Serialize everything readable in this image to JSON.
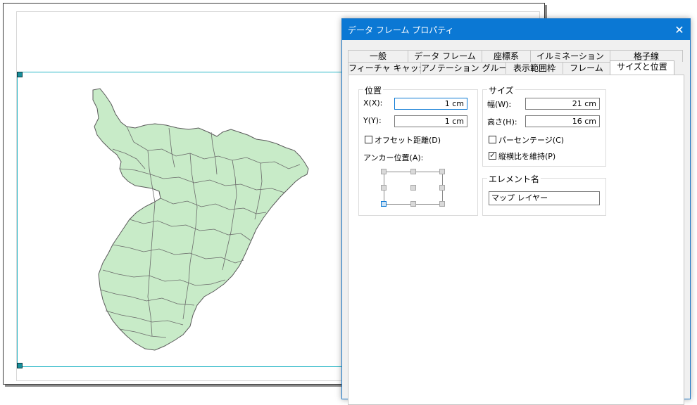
{
  "dialog": {
    "title": "データ フレーム プロパティ",
    "close_glyph": "✕",
    "tabs_row1": [
      "一般",
      "データ フレーム",
      "座標系",
      "イルミネーション",
      "格子線"
    ],
    "tabs_row2": [
      "フィーチャ キャッシュ",
      "アノテーション グループ",
      "表示範囲枠",
      "フレーム",
      "サイズと位置"
    ],
    "active_tab": "サイズと位置"
  },
  "position": {
    "title": "位置",
    "x_label": "X(X):",
    "x_value": "1 cm",
    "y_label": "Y(Y):",
    "y_value": "1 cm",
    "offset_label": "オフセット距離(D)",
    "offset_checked": false,
    "anchor_label": "アンカー位置(A):",
    "anchor_selected": "bottom-left"
  },
  "size": {
    "title": "サイズ",
    "width_label": "幅(W):",
    "width_value": "21 cm",
    "height_label": "高さ(H):",
    "height_value": "16 cm",
    "percent_label": "パーセンテージ(C)",
    "percent_checked": false,
    "aspect_label": "縦横比を維持(P)",
    "aspect_checked": true
  },
  "element": {
    "title": "エレメント名",
    "value": "マップ レイヤー"
  },
  "colors": {
    "titlebar": "#0b78d4",
    "map_fill": "#c8ebc8",
    "frame": "#27b6c6"
  }
}
